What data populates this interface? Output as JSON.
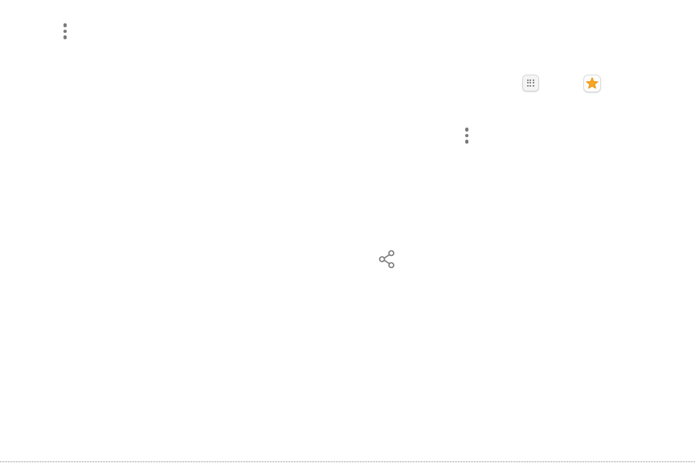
{
  "icons": {
    "more_options_top": "more-options-icon",
    "apps": "apps-icon",
    "galaxy_essentials": "star-icon",
    "more_options_mid": "more-options-icon",
    "share": "share-icon"
  },
  "colors": {
    "icon_gray": "#7a7a7a",
    "star_orange": "#f5a623"
  }
}
